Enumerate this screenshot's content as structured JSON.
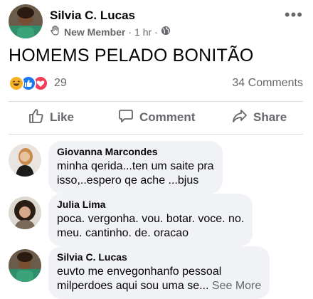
{
  "post": {
    "author": "Silvia C. Lucas",
    "badge": "New Member",
    "separator": "·",
    "time": "1 hr",
    "separator2": "·",
    "more": "•••",
    "text": "HOMEMS PELADO BONITÃO",
    "reaction_count": "29",
    "comments_count": "34 Comments"
  },
  "actions": {
    "like": "Like",
    "comment": "Comment",
    "share": "Share"
  },
  "comments": [
    {
      "name": "Giovanna Marcondes",
      "line1": "minha qerida...ten um saite pra",
      "line2": "isso,..espero qe ache ...bjus"
    },
    {
      "name": "Julia Lima",
      "line1": "poca. vergonha. vou. botar. voce. no.",
      "line2": "meu. cantinho. de. oracao"
    },
    {
      "name": "Silvia C. Lucas",
      "line1": "euvto me envegonhanfo pessoal",
      "line2": "milperdoes aqui sou uma se...",
      "see_more": "See More"
    }
  ],
  "icons": {
    "header_more": "more-dots-icon",
    "badge": "wave-hand-icon",
    "privacy": "globe-icon",
    "reactions": [
      "haha-emoji-icon",
      "like-reaction-icon",
      "love-reaction-icon"
    ],
    "like": "thumbs-up-icon",
    "comment": "speech-bubble-icon",
    "share": "share-arrow-icon"
  },
  "colors": {
    "secondary_text": "#65676b",
    "bubble": "#f0f2f5",
    "like_blue": "#1877f2",
    "love_red": "#f33e58",
    "haha_yellow": "#f7b125"
  }
}
